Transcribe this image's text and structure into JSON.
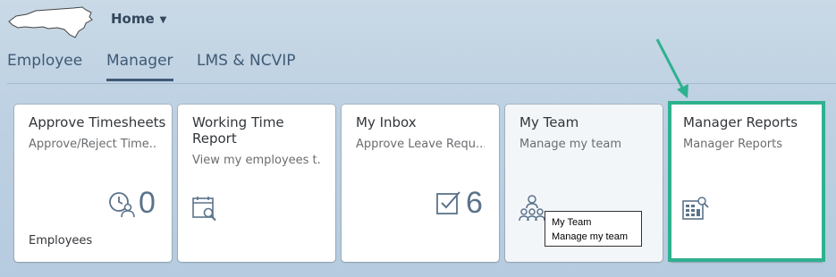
{
  "shell": {
    "home_label": "Home"
  },
  "tabs": [
    {
      "label": "Employee"
    },
    {
      "label": "Manager"
    },
    {
      "label": "LMS & NCVIP"
    }
  ],
  "active_tab": "Manager",
  "tiles": [
    {
      "title": "Approve Timesheets",
      "subtitle": "Approve/Reject Time...",
      "number": "0",
      "footer": "Employees",
      "icon": "person-clock-icon"
    },
    {
      "title": "Working Time Report",
      "subtitle": "View my employees t...",
      "icon": "calendar-search-icon"
    },
    {
      "title": "My Inbox",
      "subtitle": "Approve Leave Requ...",
      "number": "6",
      "icon": "checkbox-icon"
    },
    {
      "title": "My Team",
      "subtitle": "Manage my team",
      "icon": "team-icon"
    },
    {
      "title": "Manager Reports",
      "subtitle": "Manager Reports",
      "icon": "report-search-icon"
    }
  ],
  "tooltip": {
    "line1": "My Team",
    "line2": "Manage my team"
  },
  "colors": {
    "highlight": "#2fb18f",
    "tab_text": "#3f5a75",
    "icon": "#5b738b"
  }
}
